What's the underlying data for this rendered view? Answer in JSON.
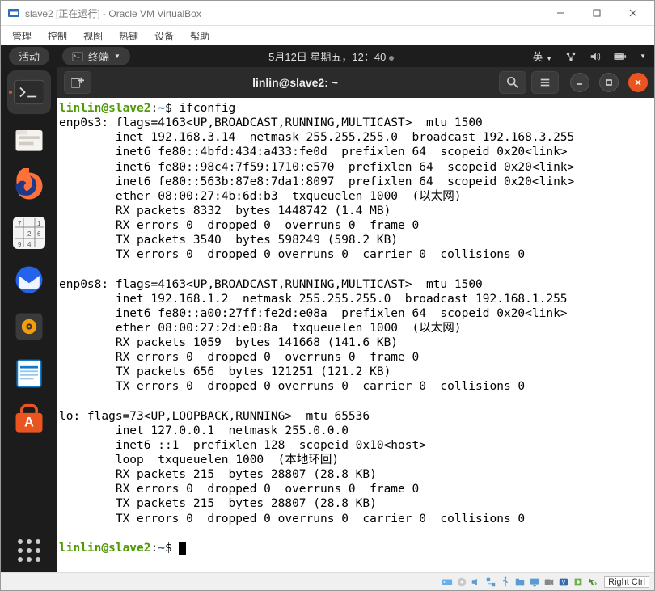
{
  "vbox": {
    "title": "slave2 [正在运行] - Oracle VM VirtualBox",
    "menu": {
      "manage": "管理",
      "control": "控制",
      "view": "视图",
      "hotkeys": "热键",
      "devices": "设备",
      "help": "帮助"
    },
    "host_key": "Right Ctrl"
  },
  "topbar": {
    "activities": "活动",
    "app_label": "终端",
    "clock": "5月12日 星期五，12：40",
    "lang": "英"
  },
  "terminal": {
    "new_tab_tooltip": "New Tab",
    "title": "linlin@slave2: ~",
    "prompt_user": "linlin@slave2",
    "prompt_sep": ":",
    "prompt_path": "~",
    "prompt_end": "$ ",
    "command": "ifconfig",
    "output": "enp0s3: flags=4163<UP,BROADCAST,RUNNING,MULTICAST>  mtu 1500\n        inet 192.168.3.14  netmask 255.255.255.0  broadcast 192.168.3.255\n        inet6 fe80::4bfd:434:a433:fe0d  prefixlen 64  scopeid 0x20<link>\n        inet6 fe80::98c4:7f59:1710:e570  prefixlen 64  scopeid 0x20<link>\n        inet6 fe80::563b:87e8:7da1:8097  prefixlen 64  scopeid 0x20<link>\n        ether 08:00:27:4b:6d:b3  txqueuelen 1000  (以太网)\n        RX packets 8332  bytes 1448742 (1.4 MB)\n        RX errors 0  dropped 0  overruns 0  frame 0\n        TX packets 3540  bytes 598249 (598.2 KB)\n        TX errors 0  dropped 0 overruns 0  carrier 0  collisions 0\n\nenp0s8: flags=4163<UP,BROADCAST,RUNNING,MULTICAST>  mtu 1500\n        inet 192.168.1.2  netmask 255.255.255.0  broadcast 192.168.1.255\n        inet6 fe80::a00:27ff:fe2d:e08a  prefixlen 64  scopeid 0x20<link>\n        ether 08:00:27:2d:e0:8a  txqueuelen 1000  (以太网)\n        RX packets 1059  bytes 141668 (141.6 KB)\n        RX errors 0  dropped 0  overruns 0  frame 0\n        TX packets 656  bytes 121251 (121.2 KB)\n        TX errors 0  dropped 0 overruns 0  carrier 0  collisions 0\n\nlo: flags=73<UP,LOOPBACK,RUNNING>  mtu 65536\n        inet 127.0.0.1  netmask 255.0.0.0\n        inet6 ::1  prefixlen 128  scopeid 0x10<host>\n        loop  txqueuelen 1000  (本地环回)\n        RX packets 215  bytes 28807 (28.8 KB)\n        RX errors 0  dropped 0  overruns 0  frame 0\n        TX packets 215  bytes 28807 (28.8 KB)\n        TX errors 0  dropped 0 overruns 0  carrier 0  collisions 0\n"
  }
}
